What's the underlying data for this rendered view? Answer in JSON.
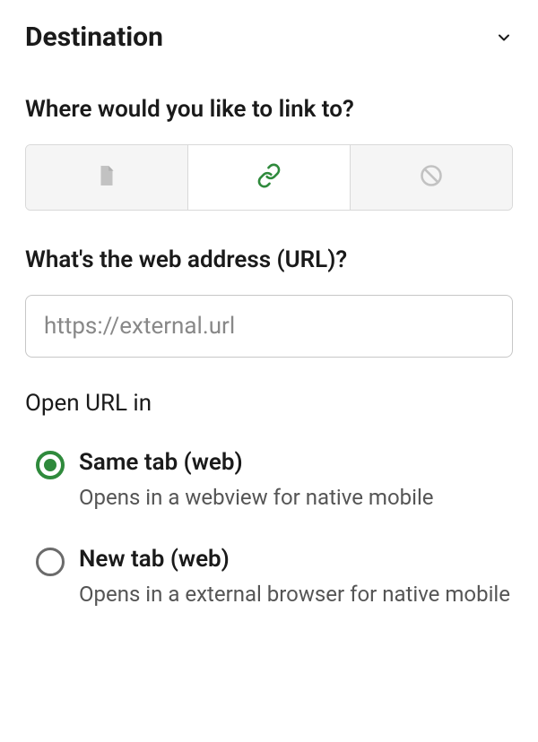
{
  "header": {
    "title": "Destination"
  },
  "link_section": {
    "label": "Where would you like to link to?"
  },
  "url_section": {
    "label": "What's the web address (URL)?",
    "placeholder": "https://external.url",
    "value": ""
  },
  "open_section": {
    "label": "Open URL in",
    "options": [
      {
        "title": "Same tab (web)",
        "desc": "Opens in a webview for native mobile",
        "selected": true
      },
      {
        "title": "New tab (web)",
        "desc": "Opens in a external browser for native mobile",
        "selected": false
      }
    ]
  },
  "tabs": {
    "selected_index": 1,
    "items": [
      "page",
      "link",
      "none"
    ]
  },
  "colors": {
    "accent": "#2f8a3c",
    "border": "#d9d9d9",
    "text": "#1a1a1a",
    "muted": "#888"
  }
}
